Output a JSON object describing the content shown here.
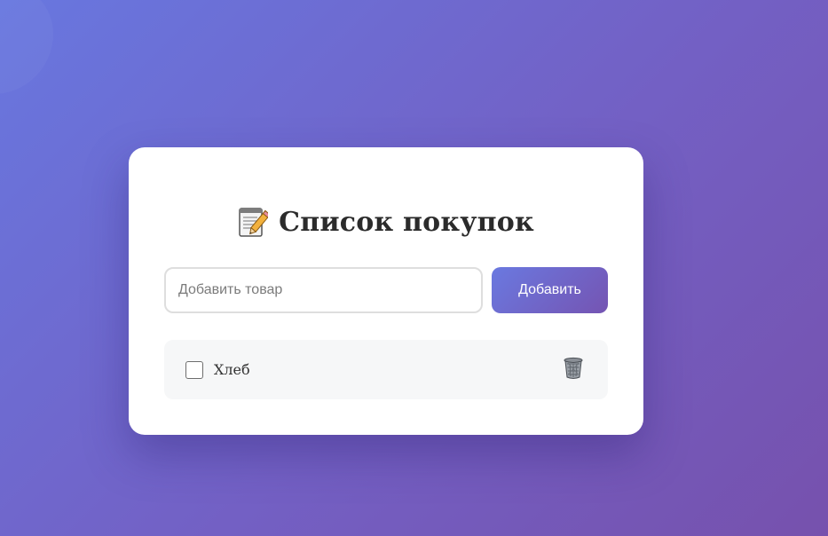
{
  "app": {
    "title": "Список покупок",
    "title_icon": "memo-pencil-icon"
  },
  "add_form": {
    "placeholder": "Добавить товар",
    "value": "",
    "button_label": "Добавить"
  },
  "items": [
    {
      "text": "Хлеб",
      "checked": false,
      "delete_icon": "trash-bin-icon"
    }
  ],
  "colors": {
    "background_start": "#6877df",
    "background_end": "#7651ad",
    "accent_start": "#6a79e0",
    "accent_end": "#7554b2",
    "card": "#ffffff",
    "item_bg": "#f6f7f8"
  }
}
